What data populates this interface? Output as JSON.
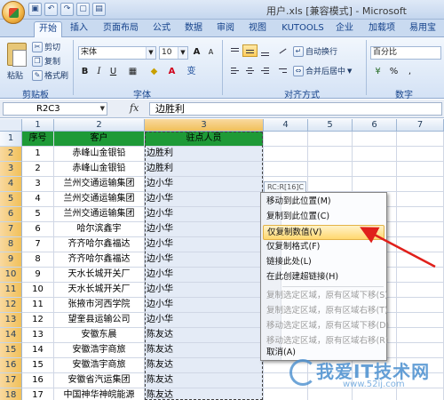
{
  "window": {
    "title": "用户.xls [兼容模式] - Microsoft",
    "quick_access": [
      "save-icon",
      "undo-icon",
      "redo-icon",
      "new-icon",
      "print-icon"
    ]
  },
  "tabs": [
    "开始",
    "插入",
    "页面布局",
    "公式",
    "数据",
    "审阅",
    "视图",
    "KUTOOLS",
    "企业",
    "加载项",
    "易用宝"
  ],
  "active_tab": "开始",
  "ribbon": {
    "clipboard": {
      "paste": "粘贴",
      "cut": "剪切",
      "copy": "复制",
      "format_painter": "格式刷",
      "label": "剪贴板"
    },
    "font": {
      "name": "宋体",
      "size": "10",
      "label": "字体",
      "bold": "B",
      "italic": "I",
      "underline": "U",
      "grow": "A",
      "shrink": "A",
      "color_a": "A",
      "phonetic": "变"
    },
    "alignment": {
      "wrap": "自动换行",
      "merge": "合并后居中",
      "label": "对齐方式"
    },
    "number": {
      "format": "百分比",
      "label": "数字"
    }
  },
  "formula_bar": {
    "name_box": "R2C3",
    "fx": "fx",
    "value": "边胜利"
  },
  "grid": {
    "col_headers": [
      "1",
      "2",
      "3",
      "4",
      "5",
      "6",
      "7"
    ],
    "row_headers": [
      "1",
      "2",
      "3",
      "4",
      "5",
      "6",
      "7",
      "8",
      "9",
      "10",
      "11",
      "12",
      "13",
      "14",
      "15",
      "16",
      "17",
      "18"
    ],
    "header_row": [
      "序号",
      "客户",
      "驻点人员"
    ],
    "rows": [
      [
        "1",
        "赤峰山金银铅",
        "边胜利"
      ],
      [
        "2",
        "赤峰山金银铅",
        "边胜利"
      ],
      [
        "3",
        "兰州交通运输集团",
        "边小华"
      ],
      [
        "4",
        "兰州交通运输集团",
        "边小华"
      ],
      [
        "5",
        "兰州交通运输集团",
        "边小华"
      ],
      [
        "6",
        "哈尔滨鑫宇",
        "边小华"
      ],
      [
        "7",
        "齐齐哈尔鑫福达",
        "边小华"
      ],
      [
        "8",
        "齐齐哈尔鑫福达",
        "边小华"
      ],
      [
        "9",
        "天水长城开关厂",
        "边小华"
      ],
      [
        "10",
        "天水长城开关厂",
        "边小华"
      ],
      [
        "11",
        "张掖市河西学院",
        "边小华"
      ],
      [
        "12",
        "望奎县运输公司",
        "边小华"
      ],
      [
        "13",
        "安徽东晨",
        "陈友达"
      ],
      [
        "14",
        "安徽浩宇商旅",
        "陈友达"
      ],
      [
        "15",
        "安徽浩宇商旅",
        "陈友达"
      ],
      [
        "16",
        "安徽省汽运集团",
        "陈友达"
      ],
      [
        "17",
        "中国神华神皖能源",
        "陈友达"
      ]
    ]
  },
  "tooltip": "RC:R[16]C",
  "context_menu": {
    "items": [
      {
        "label": "移动到此位置(M)",
        "disabled": false,
        "highlight": false
      },
      {
        "label": "复制到此位置(C)",
        "disabled": false,
        "highlight": false
      },
      {
        "label": "仅复制数值(V)",
        "disabled": false,
        "highlight": true
      },
      {
        "label": "仅复制格式(F)",
        "disabled": false,
        "highlight": false
      },
      {
        "label": "链接此处(L)",
        "disabled": false,
        "highlight": false
      },
      {
        "label": "在此创建超链接(H)",
        "disabled": false,
        "highlight": false
      },
      {
        "label": "复制选定区域，原有区域下移(S)",
        "disabled": true,
        "highlight": false
      },
      {
        "label": "复制选定区域，原有区域右移(T)",
        "disabled": true,
        "highlight": false
      },
      {
        "label": "移动选定区域，原有区域下移(D)",
        "disabled": true,
        "highlight": false
      },
      {
        "label": "移动选定区域，原有区域右移(R)",
        "disabled": true,
        "highlight": false
      },
      {
        "label": "取消(A)",
        "disabled": false,
        "highlight": false
      }
    ]
  },
  "watermark": {
    "text": "我爱IT技术网",
    "url": "www.52ij.com"
  },
  "colors": {
    "header_fill": "#1e9a37",
    "selection": "#e4ebf6",
    "menu_highlight": "#ffd76e",
    "arrow": "#e0201b"
  }
}
